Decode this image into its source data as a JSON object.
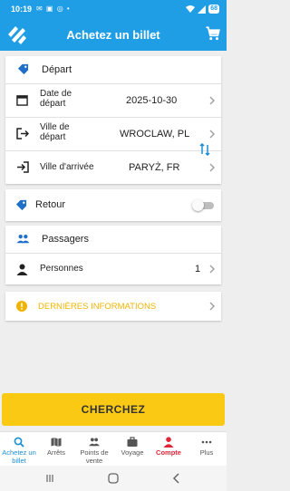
{
  "status_bar": {
    "time": "10:19",
    "battery": "68"
  },
  "app_bar": {
    "title": "Achetez un billet"
  },
  "trip": {
    "section_label": "Départ",
    "date_label": "Date de départ",
    "date_value": "2025-10-30",
    "from_label": "Ville de départ",
    "from_value": "WROCLAW, PL",
    "to_label": "Ville d'arrivée",
    "to_value": "PARYŻ, FR"
  },
  "return": {
    "label": "Retour",
    "enabled": false
  },
  "passengers": {
    "section_label": "Passagers",
    "persons_label": "Personnes",
    "persons_value": "1"
  },
  "news": {
    "label": "DERNIÈRES INFORMATIONS",
    "color": "#f0b400"
  },
  "search_button": {
    "label": "CHERCHEZ",
    "color": "#f9c913"
  },
  "bottom_nav": [
    {
      "label": "Achetez un billet",
      "icon": "search-icon",
      "active": true
    },
    {
      "label": "Arrêts",
      "icon": "map-icon"
    },
    {
      "label": "Points de vente",
      "icon": "people-icon"
    },
    {
      "label": "Voyage",
      "icon": "briefcase-icon"
    },
    {
      "label": "Compte",
      "icon": "person-icon"
    },
    {
      "label": "Plus",
      "icon": "more-icon"
    }
  ],
  "colors": {
    "primary": "#1f9ee6",
    "accent_blue": "#1a8fd6",
    "account_red": "#e02437"
  }
}
